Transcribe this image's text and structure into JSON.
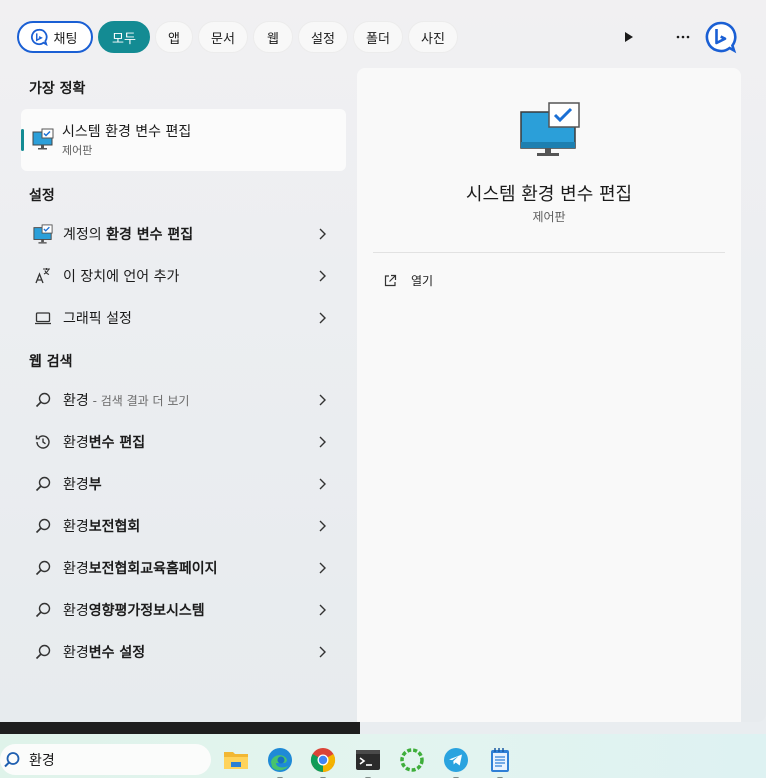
{
  "filters": {
    "chat": "채팅",
    "all": "모두",
    "apps": "앱",
    "documents": "문서",
    "web": "웹",
    "settings": "설정",
    "folders": "폴더",
    "photos": "사진"
  },
  "best_match": {
    "heading": "가장 정확",
    "title": "시스템 환경 변수 편집",
    "subtitle": "제어판"
  },
  "settings_section": {
    "heading": "설정",
    "items": [
      {
        "pre": "계정의 ",
        "match": "환경 변수 편집",
        "post": ""
      },
      {
        "pre": "이 장치에 언어 추가",
        "match": "",
        "post": ""
      },
      {
        "pre": "그래픽 설정",
        "match": "",
        "post": ""
      }
    ]
  },
  "web_section": {
    "heading": "웹 검색",
    "first": {
      "query": "환경",
      "hint": " - 검색 결과 더 보기"
    },
    "items": [
      {
        "pre": "환경",
        "match": "변수 편집"
      },
      {
        "pre": "환경",
        "match": "부"
      },
      {
        "pre": "환경",
        "match": "보전협회"
      },
      {
        "pre": "환경",
        "match": "보전협회교육홈페이지"
      },
      {
        "pre": "환경",
        "match": "영향평가정보시스템"
      },
      {
        "pre": "환경",
        "match": "변수 설정"
      }
    ]
  },
  "preview": {
    "title": "시스템 환경 변수 편집",
    "subtitle": "제어판",
    "open_label": "열기"
  },
  "taskbar": {
    "search_value": "환경"
  },
  "colors": {
    "accent": "#138b93",
    "bing_blue": "#1a5fd4"
  }
}
